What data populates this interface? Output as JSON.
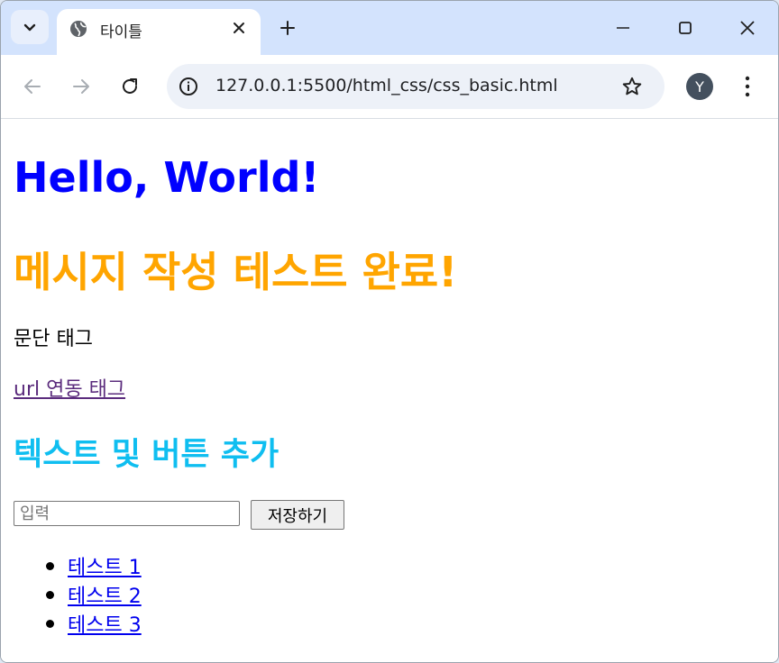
{
  "browser": {
    "tab_title": "타이틀",
    "url": "127.0.0.1:5500/html_css/css_basic.html",
    "profile_initial": "Y"
  },
  "icons": {
    "tab_search": "chevron-down-icon",
    "favicon": "globe-icon",
    "tab_close": "close-icon",
    "new_tab": "plus-icon",
    "minimize": "minimize-icon",
    "maximize": "maximize-icon",
    "window_close": "close-icon",
    "back": "arrow-left-icon",
    "forward": "arrow-right-icon",
    "reload": "reload-icon",
    "site_info": "info-icon",
    "bookmark": "star-icon",
    "menu": "more-vertical-icon"
  },
  "page": {
    "heading_hello": "Hello, World!",
    "heading_message": "메시지 작성 테스트 완료!",
    "paragraph": "문단 태그",
    "link_text": "url 연동 태그",
    "subheading": "텍스트 및 버튼 추가",
    "input_placeholder": "입력",
    "input_value": "",
    "save_button": "저장하기",
    "list_items": [
      "테스트 1",
      "테스트 2",
      "테스트 3"
    ]
  },
  "colors": {
    "heading_hello": "#0000ff",
    "heading_message": "#ffa500",
    "subheading": "#0fbef0",
    "link_visited": "#5b2c7d",
    "link": "#0000ee",
    "tabstrip": "#d3e3fd"
  }
}
